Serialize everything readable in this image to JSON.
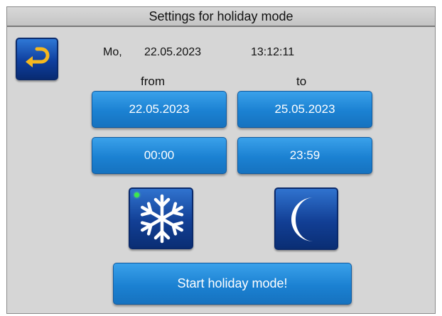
{
  "header": {
    "title": "Settings for holiday mode"
  },
  "back": {
    "icon": "back-arrow-icon"
  },
  "status": {
    "day": "Mo,",
    "date": "22.05.2023",
    "time": "13:12:11"
  },
  "range": {
    "from_label": "from",
    "to_label": "to",
    "from_date": "22.05.2023",
    "to_date": "25.05.2023",
    "from_time": "00:00",
    "to_time": "23:59"
  },
  "modes": {
    "frost_icon": "snowflake-icon",
    "frost_active": true,
    "night_icon": "moon-icon"
  },
  "actions": {
    "start_label": "Start holiday mode!"
  },
  "colors": {
    "accent": "#1b81d2",
    "dark_button": "#123f95",
    "background": "#d6d6d6",
    "indicator": "#3ee84a",
    "back_arrow": "#f5b81e"
  }
}
